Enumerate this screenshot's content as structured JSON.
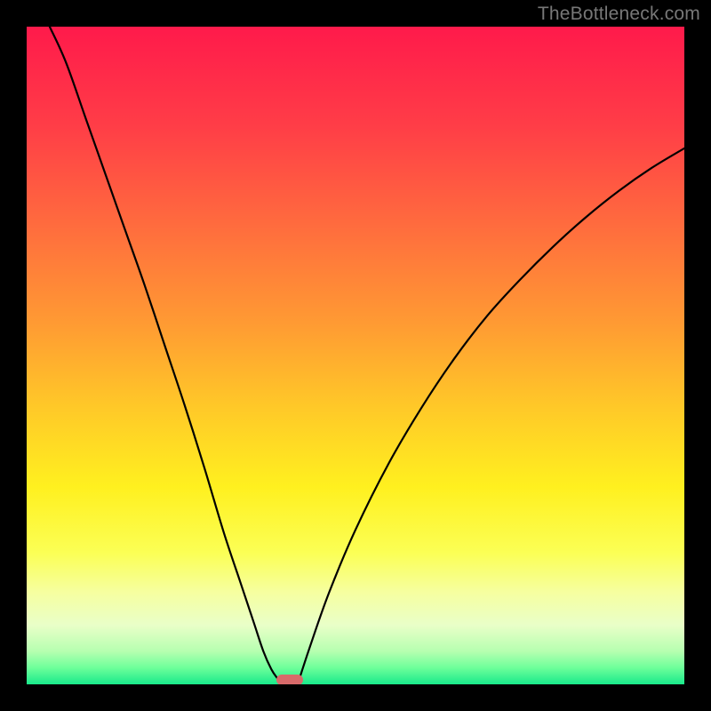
{
  "watermark": "TheBottleneck.com",
  "chart_data": {
    "type": "line",
    "title": "",
    "xlabel": "",
    "ylabel": "",
    "xlim": [
      0,
      1
    ],
    "ylim": [
      0,
      1
    ],
    "series": [
      {
        "name": "left-curve",
        "x": [
          0.035,
          0.06,
          0.09,
          0.12,
          0.15,
          0.18,
          0.21,
          0.24,
          0.27,
          0.3,
          0.325,
          0.345,
          0.36,
          0.372,
          0.382,
          0.388
        ],
        "y": [
          1.0,
          0.945,
          0.86,
          0.775,
          0.69,
          0.605,
          0.515,
          0.425,
          0.33,
          0.23,
          0.155,
          0.095,
          0.05,
          0.023,
          0.008,
          0.0
        ]
      },
      {
        "name": "right-curve",
        "x": [
          0.412,
          0.43,
          0.46,
          0.5,
          0.55,
          0.6,
          0.65,
          0.7,
          0.75,
          0.8,
          0.85,
          0.9,
          0.95,
          1.0
        ],
        "y": [
          0.0,
          0.055,
          0.14,
          0.235,
          0.335,
          0.42,
          0.495,
          0.56,
          0.615,
          0.665,
          0.71,
          0.75,
          0.785,
          0.815
        ]
      }
    ],
    "marker": {
      "x": 0.4,
      "y": 0.0,
      "color": "#d86a6a"
    },
    "background_gradient": {
      "stops": [
        {
          "offset": 0.0,
          "color": "#ff1a4b"
        },
        {
          "offset": 0.15,
          "color": "#ff3d47"
        },
        {
          "offset": 0.3,
          "color": "#ff6b3e"
        },
        {
          "offset": 0.45,
          "color": "#ff9a33"
        },
        {
          "offset": 0.58,
          "color": "#ffc928"
        },
        {
          "offset": 0.7,
          "color": "#fff01f"
        },
        {
          "offset": 0.8,
          "color": "#fbff55"
        },
        {
          "offset": 0.86,
          "color": "#f6ffa0"
        },
        {
          "offset": 0.91,
          "color": "#e9ffc8"
        },
        {
          "offset": 0.95,
          "color": "#b6ffb0"
        },
        {
          "offset": 0.975,
          "color": "#6dff9a"
        },
        {
          "offset": 1.0,
          "color": "#19e98b"
        }
      ]
    }
  }
}
